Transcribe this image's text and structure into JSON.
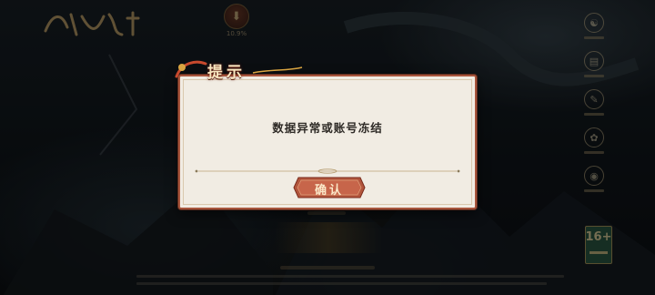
{
  "download": {
    "percent_text": "10.9%"
  },
  "dialog": {
    "title": "提示",
    "message": "数据异常或账号冻结",
    "confirm_label": "确认"
  },
  "age_rating": {
    "number": "16+"
  }
}
